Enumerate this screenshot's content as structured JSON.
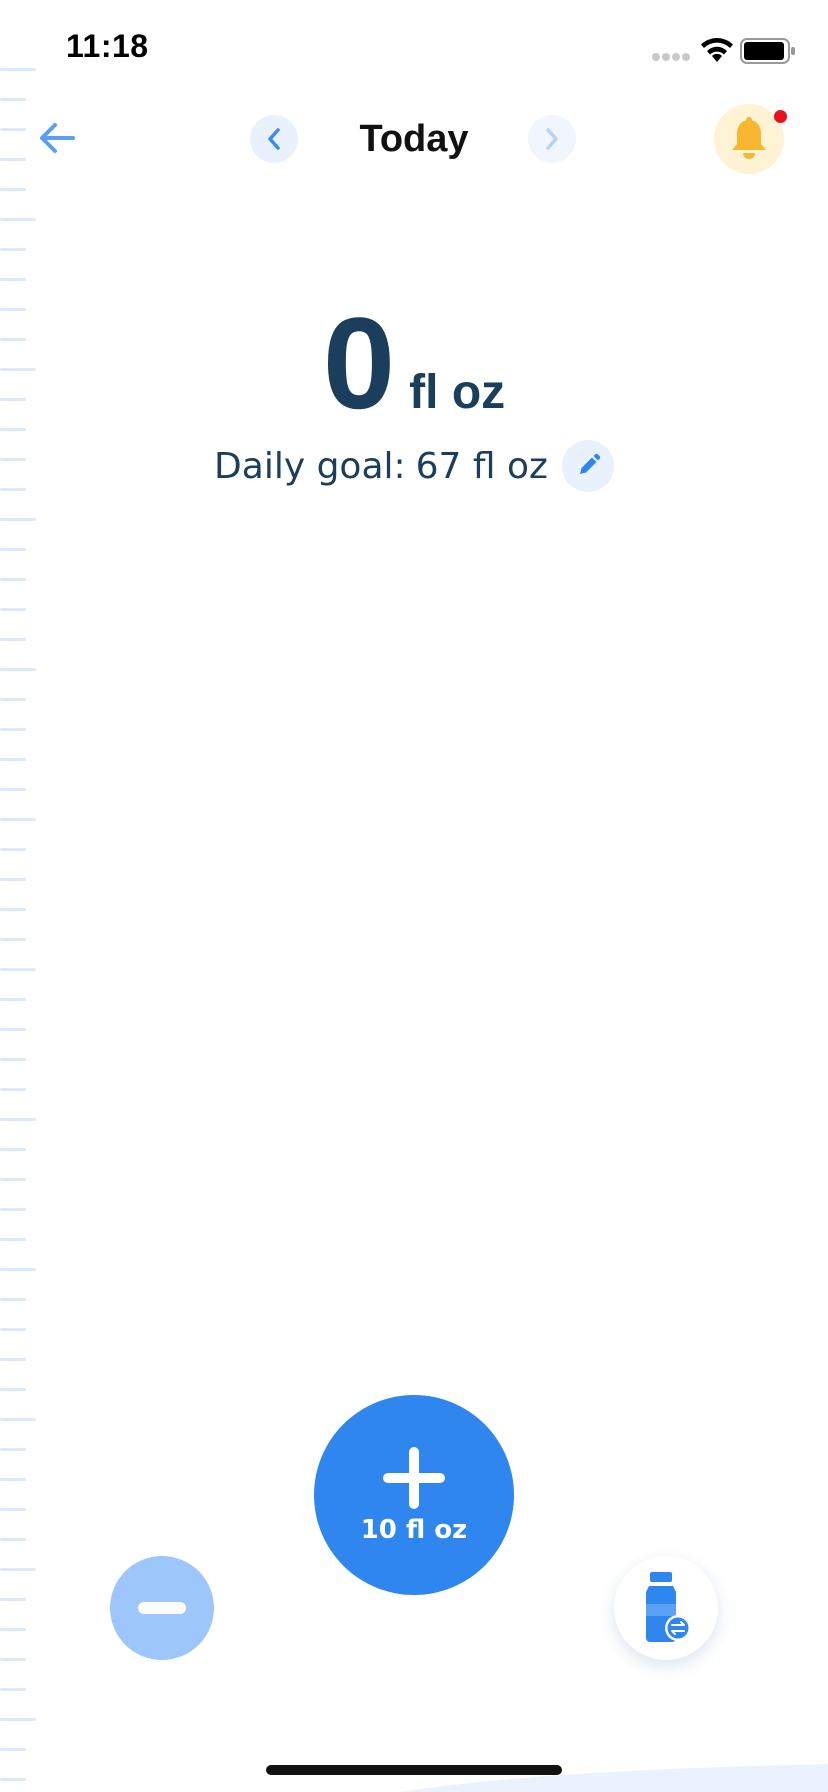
{
  "status_bar": {
    "time": "11:18"
  },
  "nav": {
    "title": "Today"
  },
  "intake": {
    "value": "0",
    "unit": "fl oz",
    "progress_fraction": 0
  },
  "goal": {
    "label": "Daily goal:",
    "value": "67 fl oz"
  },
  "add_button": {
    "label": "10 fl oz"
  },
  "icons": {
    "back": "arrow-left-icon",
    "prev": "chevron-left-icon",
    "next": "chevron-right-icon",
    "bell": "bell-icon",
    "edit": "pencil-icon",
    "add": "plus-icon",
    "remove": "minus-icon",
    "cup": "bottle-switch-icon"
  },
  "colors": {
    "accent": "#2f86ee",
    "accent_light": "#9dc6fa",
    "text_dark": "#1a3e5b",
    "bell_bg": "#fff3d6",
    "bell": "#f7b731",
    "notification": "#e8141c",
    "ruler": "#dbe9f8"
  }
}
